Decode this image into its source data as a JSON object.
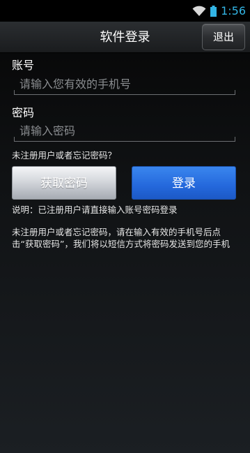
{
  "status_bar": {
    "time": "1:56",
    "wifi_icon": "wifi-icon",
    "battery_icon": "battery-icon",
    "accent_color": "#33b5e5"
  },
  "header": {
    "title": "软件登录",
    "exit_label": "退出"
  },
  "form": {
    "account_label": "账号",
    "account_placeholder": "请输入您有效的手机号",
    "account_value": "",
    "password_label": "密码",
    "password_placeholder": "请输入密码",
    "password_value": "",
    "forgot_prompt": "未注册用户或者忘记密码？",
    "get_password_label": "获取密码",
    "login_label": "登录",
    "login_color": "#2468dc"
  },
  "notes": {
    "explanation": "说明：已注册用户请直接输入账号密码登录",
    "instructions": "未注册用户或者忘记密码，请在输入有效的手机号后点击“获取密码”，我们将以短信方式将密码发送到您的手机"
  }
}
